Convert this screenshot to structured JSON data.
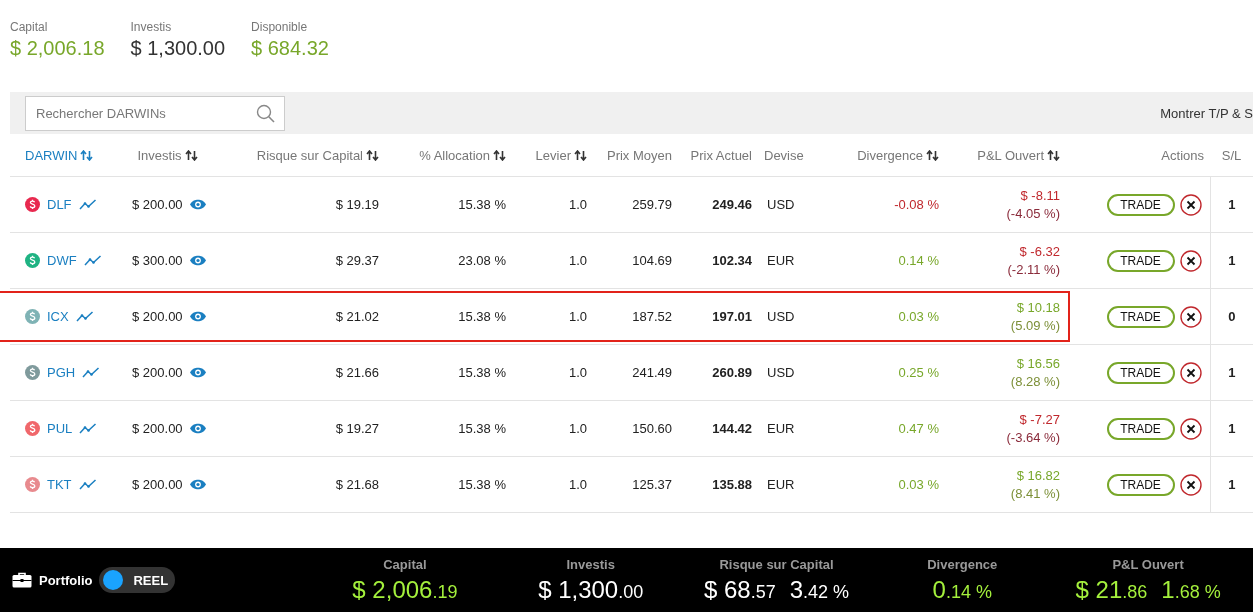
{
  "summary": [
    {
      "label": "Capital",
      "value": "$ 2,006.18",
      "positive": true
    },
    {
      "label": "Investis",
      "value": "$ 1,300.00",
      "positive": false
    },
    {
      "label": "Disponible",
      "value": "$ 684.32",
      "positive": true
    }
  ],
  "toolbar": {
    "search": {
      "placeholder": "Rechercher DARWINs"
    },
    "toggle_label": "Montrer T/P & S"
  },
  "table": {
    "columns": [
      {
        "label": "DARWIN",
        "sortable": true
      },
      {
        "label": "Investis",
        "sortable": true
      },
      {
        "label": "Risque sur Capital",
        "sortable": true
      },
      {
        "label": "% Allocation",
        "sortable": true
      },
      {
        "label": "Levier",
        "sortable": true
      },
      {
        "label": "Prix Moyen",
        "sortable": false
      },
      {
        "label": "Prix Actuel",
        "sortable": false
      },
      {
        "label": "Devise",
        "sortable": false
      },
      {
        "label": "Divergence",
        "sortable": true
      },
      {
        "label": "P&L Ouvert",
        "sortable": true
      },
      {
        "label": "Actions",
        "sortable": false
      },
      {
        "label": "S/L",
        "sortable": false
      }
    ],
    "rows": [
      {
        "name": "DLF",
        "color": "#e8294f",
        "invested": "$ 200.00",
        "risk": "$ 19.19",
        "allocation": "15.38 %",
        "leverage": "1.0",
        "avg_price": "259.79",
        "current_price": "249.46",
        "currency": "USD",
        "divergence": "-0.08 %",
        "divergence_positive": false,
        "pnl": "$ -8.11",
        "pnl_pct": "(-4.05 %)",
        "pnl_positive": false,
        "action": "TRADE",
        "sl": "1",
        "highlighted": false
      },
      {
        "name": "DWF",
        "color": "#1fb383",
        "invested": "$ 300.00",
        "risk": "$ 29.37",
        "allocation": "23.08 %",
        "leverage": "1.0",
        "avg_price": "104.69",
        "current_price": "102.34",
        "currency": "EUR",
        "divergence": "0.14 %",
        "divergence_positive": true,
        "pnl": "$ -6.32",
        "pnl_pct": "(-2.11 %)",
        "pnl_positive": false,
        "action": "TRADE",
        "sl": "1",
        "highlighted": false
      },
      {
        "name": "ICX",
        "color": "#7fb3b5",
        "invested": "$ 200.00",
        "risk": "$ 21.02",
        "allocation": "15.38 %",
        "leverage": "1.0",
        "avg_price": "187.52",
        "current_price": "197.01",
        "currency": "USD",
        "divergence": "0.03 %",
        "divergence_positive": true,
        "pnl": "$ 10.18",
        "pnl_pct": "(5.09 %)",
        "pnl_positive": true,
        "action": "TRADE",
        "sl": "0",
        "highlighted": true
      },
      {
        "name": "PGH",
        "color": "#7f9a9c",
        "invested": "$ 200.00",
        "risk": "$ 21.66",
        "allocation": "15.38 %",
        "leverage": "1.0",
        "avg_price": "241.49",
        "current_price": "260.89",
        "currency": "USD",
        "divergence": "0.25 %",
        "divergence_positive": true,
        "pnl": "$ 16.56",
        "pnl_pct": "(8.28 %)",
        "pnl_positive": true,
        "action": "TRADE",
        "sl": "1",
        "highlighted": false
      },
      {
        "name": "PUL",
        "color": "#f0676b",
        "invested": "$ 200.00",
        "risk": "$ 19.27",
        "allocation": "15.38 %",
        "leverage": "1.0",
        "avg_price": "150.60",
        "current_price": "144.42",
        "currency": "EUR",
        "divergence": "0.47 %",
        "divergence_positive": true,
        "pnl": "$ -7.27",
        "pnl_pct": "(-3.64 %)",
        "pnl_positive": false,
        "action": "TRADE",
        "sl": "1",
        "highlighted": false
      },
      {
        "name": "TKT",
        "color": "#e88a8e",
        "invested": "$ 200.00",
        "risk": "$ 21.68",
        "allocation": "15.38 %",
        "leverage": "1.0",
        "avg_price": "125.37",
        "current_price": "135.88",
        "currency": "EUR",
        "divergence": "0.03 %",
        "divergence_positive": true,
        "pnl": "$ 16.82",
        "pnl_pct": "(8.41 %)",
        "pnl_positive": true,
        "action": "TRADE",
        "sl": "1",
        "highlighted": false
      }
    ]
  },
  "footer": {
    "portfolio_label": "Portfolio",
    "mode_toggle": {
      "label": "REEL",
      "on": true
    },
    "stats": [
      {
        "label": "Capital",
        "values": [
          {
            "main": "$ 2,006",
            "minor": ".19",
            "positive": true
          }
        ]
      },
      {
        "label": "Investis",
        "values": [
          {
            "main": "$ 1,300",
            "minor": ".00",
            "positive": false
          }
        ]
      },
      {
        "label": "Risque sur Capital",
        "values": [
          {
            "main": "$ 68",
            "minor": ".57",
            "positive": false
          },
          {
            "main": "3",
            "minor": ".42 %",
            "positive": false
          }
        ]
      },
      {
        "label": "Divergence",
        "values": [
          {
            "main": "0",
            "minor": ".14 %",
            "positive": true
          }
        ]
      },
      {
        "label": "P&L Ouvert",
        "values": [
          {
            "main": "$ 21",
            "minor": ".86",
            "positive": true
          },
          {
            "main": "1",
            "minor": ".68 %",
            "positive": true
          }
        ]
      }
    ]
  }
}
